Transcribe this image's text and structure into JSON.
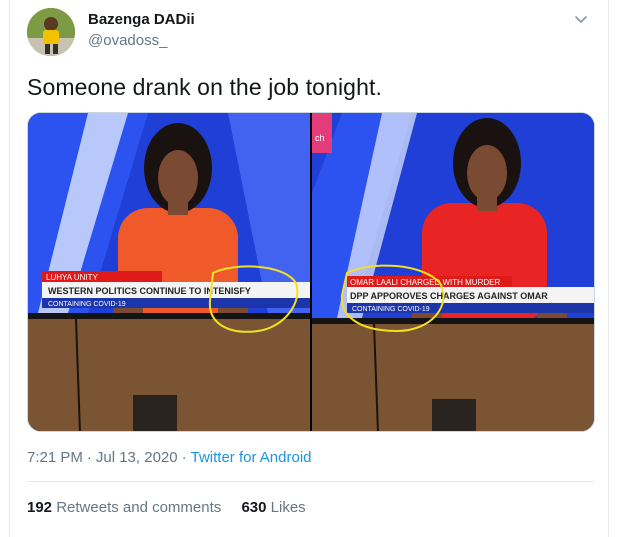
{
  "user": {
    "name": "Bazenga DADii",
    "handle": "@ovadoss_"
  },
  "tweet": {
    "text": "Someone drank on the job tonight."
  },
  "photos": {
    "left": {
      "lower_third_tag": "LUHYA UNITY",
      "headline": "WESTERN POLITICS CONTINUE TO INTENISFY",
      "ticker": "CONTAINING COVID-19"
    },
    "right": {
      "lower_third_tag": "OMAR LAALI CHARGED WITH MURDER",
      "headline": "DPP APPOROVES CHARGES AGAINST OMAR",
      "ticker": "CONTAINING COVID-19",
      "corner_logo": "ch"
    }
  },
  "meta": {
    "time": "7:21 PM",
    "date": "Jul 13, 2020",
    "separator": "·",
    "source": "Twitter for Android"
  },
  "stats": {
    "retweets_count": "192",
    "retweets_label": "Retweets and comments",
    "likes_count": "630",
    "likes_label": "Likes"
  },
  "colors": {
    "accent": "#1b95e0",
    "secondary_text": "#657786",
    "annotation": "#f4e020"
  }
}
